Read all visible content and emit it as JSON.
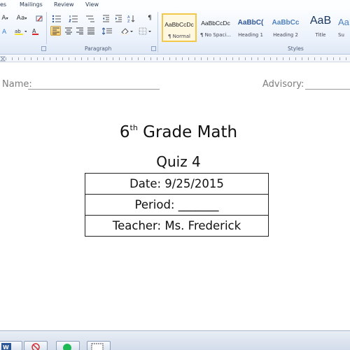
{
  "menu_tabs": [
    "es",
    "Mailings",
    "Review",
    "View"
  ],
  "ribbon": {
    "font_size_glyphs": {
      "grow": "A",
      "case": "Aa",
      "shrink_arrow": "▾"
    },
    "paragraph_mark": "¶",
    "group_labels": {
      "paragraph": "Paragraph",
      "styles": "Styles"
    },
    "styles": [
      {
        "sample": "AaBbCcDc",
        "name": "¶ Normal",
        "active": true
      },
      {
        "sample": "AaBbCcDc",
        "name": "¶ No Spaci...",
        "active": false
      },
      {
        "sample": "AaBbC(",
        "name": "Heading 1",
        "active": false
      },
      {
        "sample": "AaBbCc",
        "name": "Heading 2",
        "active": false
      },
      {
        "sample": "AaB",
        "name": "Title",
        "active": false
      },
      {
        "sample": "AaB",
        "name": "Su",
        "active": false
      }
    ],
    "colors": {
      "accent": "#f2c84b",
      "heading": "#2f5597"
    }
  },
  "document": {
    "name_label": "Name:",
    "advisory_label": "Advisory:",
    "title_prefix": "6",
    "title_sup": "th",
    "title_suffix": " Grade Math",
    "subtitle": "Quiz 4",
    "rows": {
      "date": "Date:   9/25/2015",
      "period": "Period: _______",
      "teacher": "Teacher: Ms. Frederick"
    }
  },
  "taskbar": {
    "items": [
      "word-app",
      "no-symbol-app",
      "green-app",
      "screen-snip-app"
    ]
  }
}
